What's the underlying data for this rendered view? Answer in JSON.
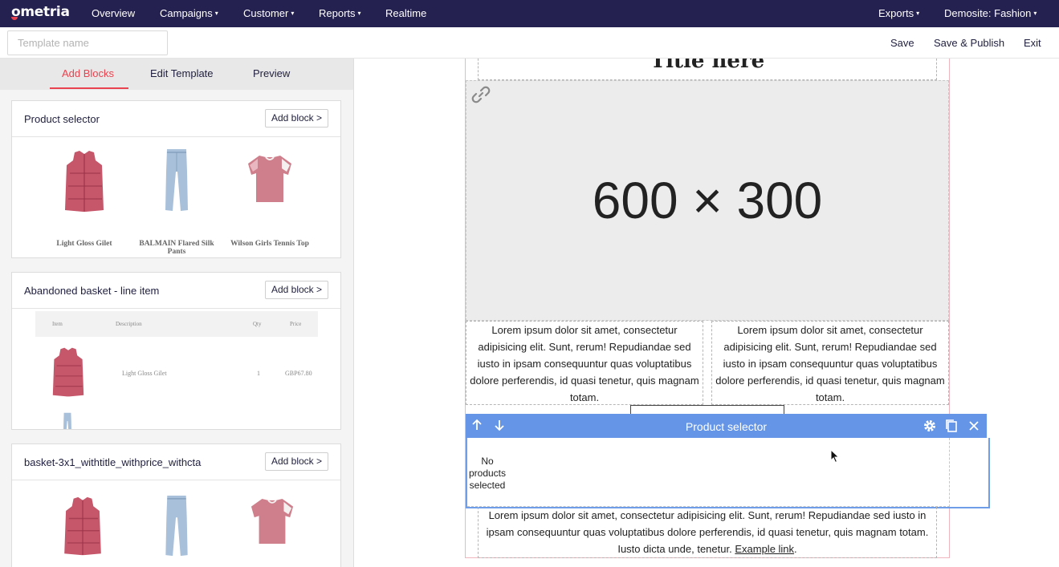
{
  "nav": {
    "logo": "ometria",
    "items": [
      "Overview",
      "Campaigns",
      "Customer",
      "Reports",
      "Realtime"
    ],
    "exports": "Exports",
    "site": "Demosite: Fashion"
  },
  "toolbar": {
    "template_placeholder": "Template name",
    "save": "Save",
    "save_publish": "Save & Publish",
    "exit": "Exit"
  },
  "tabs": {
    "add_blocks": "Add Blocks",
    "edit_template": "Edit Template",
    "preview": "Preview"
  },
  "blocks": [
    {
      "title": "Product selector",
      "button": "Add block >",
      "products": [
        "Light Gloss Gilet",
        "BALMAIN Flared Silk Pants",
        "Wilson Girls Tennis Top"
      ]
    },
    {
      "title": "Abandoned basket - line item",
      "button": "Add block >",
      "table": {
        "headers": [
          "Item",
          "Description",
          "Qty",
          "Price"
        ],
        "row": {
          "description": "Light Gloss Gilet",
          "qty": "1",
          "price": "GBP67.80"
        }
      }
    },
    {
      "title": "basket-3x1_withtitle_withprice_withcta",
      "button": "Add block >"
    }
  ],
  "canvas": {
    "title": "Title here",
    "hero": "600 × 300",
    "col_text": "Lorem ipsum dolor sit amet, consectetur adipisicing elit. Sunt, rerum! Repudiandae sed iusto in ipsam consequuntur quas voluptatibus dolore perferendis, id quasi tenetur, quis magnam totam.",
    "selected_block": "Product selector",
    "no_products": "No products selected",
    "bottom_text": "Lorem ipsum dolor sit amet, consectetur adipisicing elit. Sunt, rerum! Repudiandae sed iusto in ipsam consequuntur quas voluptatibus dolore perferendis, id quasi tenetur, quis magnam totam. Iusto dicta unde, tenetur.",
    "example_link": "Example link"
  },
  "colors": {
    "nav_bg": "#242050",
    "accent": "#e8434e",
    "selection_blue": "#6495e6"
  }
}
